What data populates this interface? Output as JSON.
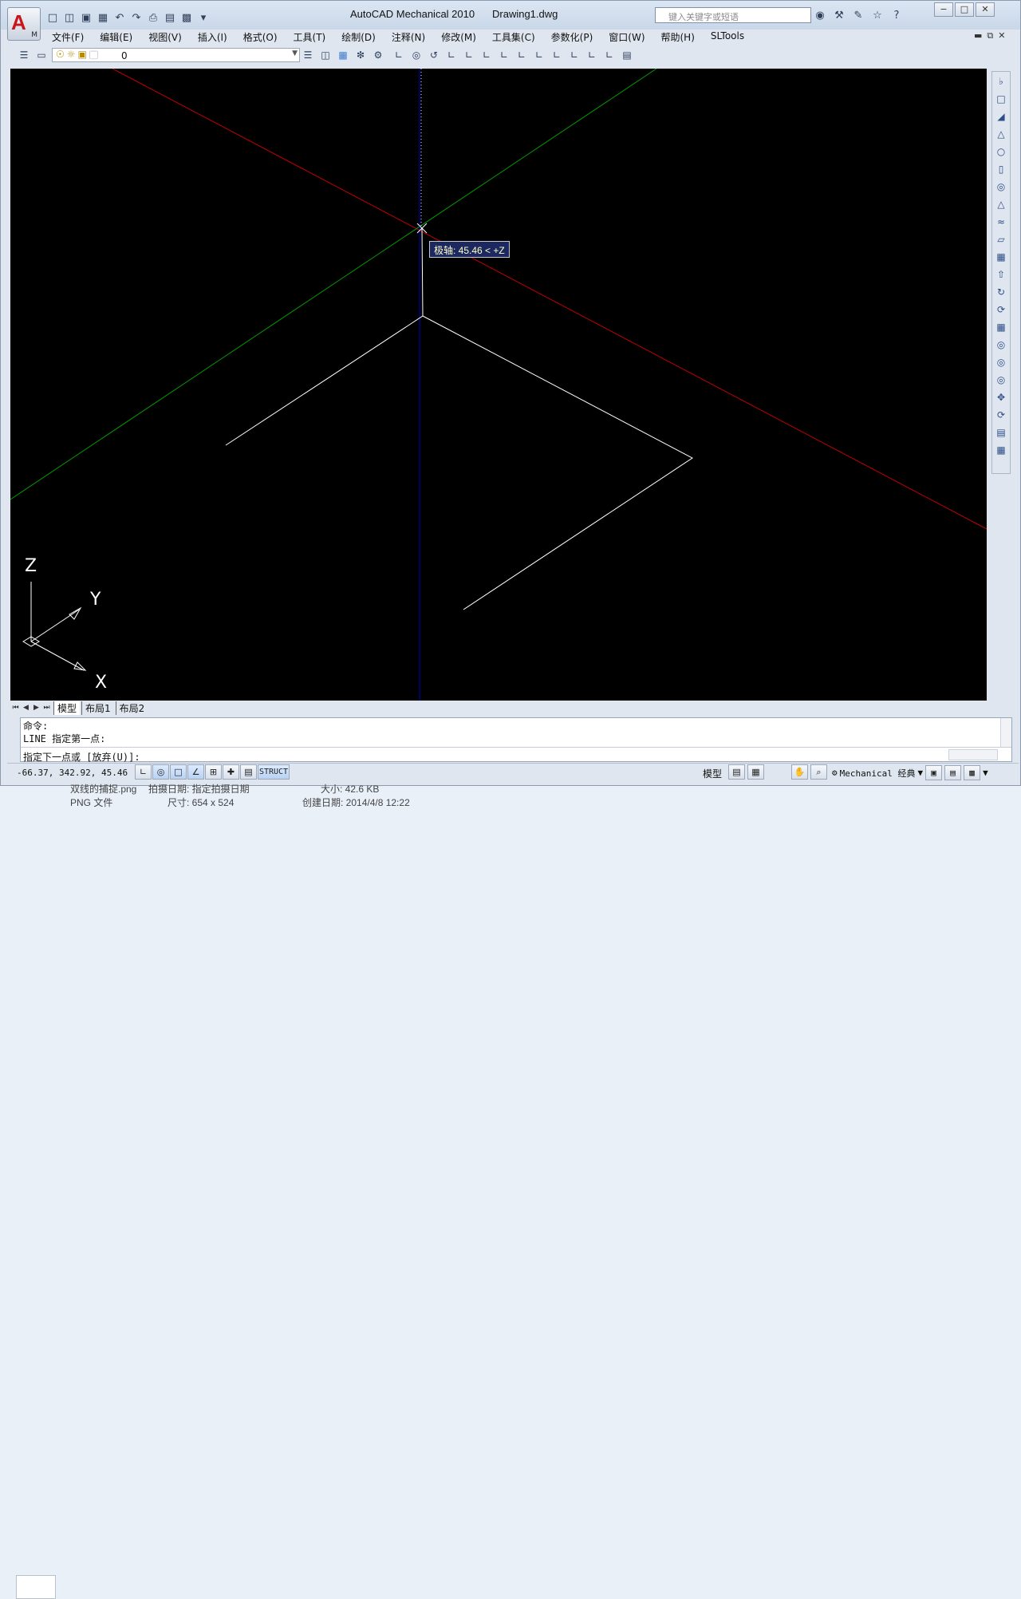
{
  "window": {
    "app_title": "AutoCAD Mechanical 2010",
    "document_title": "Drawing1.dwg",
    "app_button_letter": "A",
    "app_button_sub": "M",
    "search_placeholder": "键入关键字或短语",
    "controls": [
      "−",
      "□",
      "✕"
    ]
  },
  "menu": {
    "items": [
      "文件(F)",
      "编辑(E)",
      "视图(V)",
      "插入(I)",
      "格式(O)",
      "工具(T)",
      "绘制(D)",
      "注释(N)",
      "修改(M)",
      "工具集(C)",
      "参数化(P)",
      "窗口(W)",
      "帮助(H)",
      "SLTools"
    ]
  },
  "layer_toolbar": {
    "current_layer": "0"
  },
  "viewport": {
    "tooltip": "极轴: 45.46 < +Z",
    "axes_labels": {
      "z": "Z",
      "y": "Y",
      "x": "X"
    },
    "colors": {
      "background": "#000000",
      "x_axis": "#c00000",
      "y_axis": "#00a000",
      "z_axis": "#0000c8",
      "geometry": "#ffffff"
    }
  },
  "layout_tabs": [
    "模型",
    "布局1",
    "布局2"
  ],
  "command_line": {
    "history": [
      "命令:",
      "LINE 指定第一点:"
    ],
    "prompt": "指定下一点或 [放弃(U)]:"
  },
  "status_bar": {
    "coordinates": "-66.37, 342.92, 45.46",
    "struct_label": "STRUCT",
    "model_label": "模型",
    "workspace": "Mechanical 经典"
  },
  "file_info": {
    "filename": "双线的捕捉.png",
    "date_label": "拍摄日期: 指定拍摄日期",
    "size_label": "大小: 42.6 KB",
    "type": "PNG 文件",
    "dimensions": "尺寸: 654 x 524",
    "created": "创建日期: 2014/4/8 12:22"
  }
}
